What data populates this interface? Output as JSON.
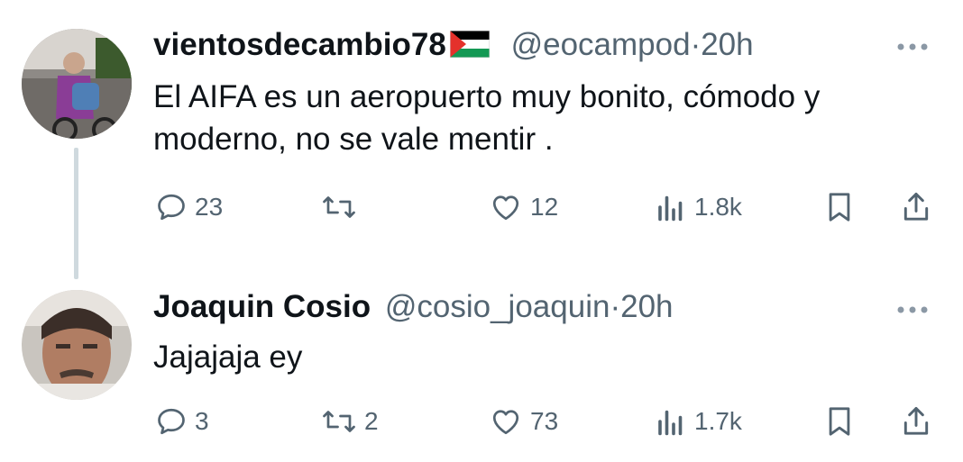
{
  "tweets": [
    {
      "name": "vientosdecambio78",
      "flag_icon": "palestine-flag-icon",
      "handle": "@eocampod",
      "separator": "·",
      "time": "20h",
      "text": "El AIFA es un aeropuerto muy bonito, cómodo y moderno, no se vale mentir .",
      "replies": "23",
      "reposts": "",
      "likes": "12",
      "views": "1.8k"
    },
    {
      "name": "Joaquin Cosio",
      "handle": "@cosio_joaquin",
      "separator": "·",
      "time": "20h",
      "text": "Jajajaja ey",
      "replies": "3",
      "reposts": "2",
      "likes": "73",
      "views": "1.7k"
    }
  ],
  "colors": {
    "text": "#0f1419",
    "secondary": "#536471",
    "thread": "#cfd9de"
  },
  "icons": [
    "reply-icon",
    "repost-icon",
    "like-icon",
    "views-icon",
    "bookmark-icon",
    "share-icon",
    "more-icon"
  ]
}
